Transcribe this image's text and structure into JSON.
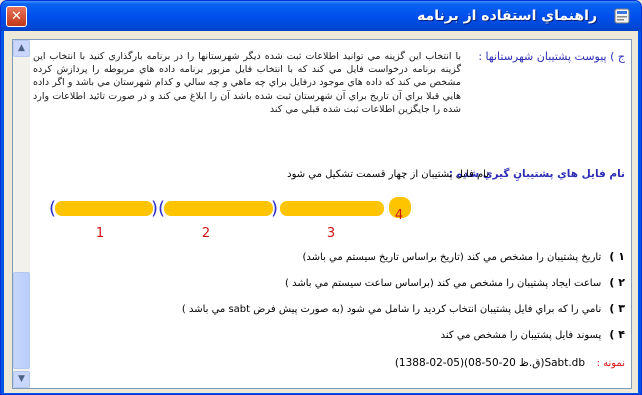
{
  "window": {
    "title": "راهنماي استفاده از برنامه",
    "close_glyph": "✕"
  },
  "section": {
    "heading": "ج )  پيوست پشتيبان شهرستانها :",
    "paragraph": "با انتخاب اين گزينه مي توانيد اطلاعات ثبت شده ديگر شهرستانها را در برنامه بارگذاري كنيد با انتخاب اين گزينه برنامه درخواست فايل مي كند كه با انتخاب فايل مزبور برنامه داده هاي مربوطه را پردازش كرده مشخص مي كند كه داده هاي موجود درفايل براي چه ماهي و چه سالي و كدام شهرستان مي باشد و اگر داده هايي قبلا براي آن تاريخ براي آن شهرستان ثبت شده باشد آن را ابلاغ مي كند و در صورت تائيد اطلاعات وارد شده را جايگزين اطلاعات ثبت شده قبلي مي كند"
  },
  "file_format": {
    "label": "نام فايل هاي پشتيبانِ گيري شده :",
    "description": "نام فايل پشتيبان از چهار قسمت تشكيل مي شود",
    "diagram": {
      "segment_numbers": [
        "1",
        "2",
        "3",
        "4"
      ]
    },
    "items": [
      {
        "num": "۱ )",
        "text": "تاريخ پشتيبان را مشخص مي كند (تاريخ براساس تاريخ سيستم مي باشد)"
      },
      {
        "num": "۲ )",
        "text": "ساعت ايجاد پشتيبان را مشخص مي كند (براساس ساعت سيستم مي باشد )"
      },
      {
        "num": "۳ )",
        "text": "نامي را كه براي فايل پشتيبان انتخاب كرديد را شامل مي شود (به صورت پيش فرض sabt مي باشد )"
      },
      {
        "num": "۴ )",
        "text": "پسوند فايل پشتيبان را مشخص مي كند"
      }
    ],
    "example_label": "نمونه :",
    "example_value": "(1388-02-05)(08-50-20 ق.ظ)Sabt.db"
  },
  "colors": {
    "heading_blue": "#2d2db5",
    "segment_yellow": "#ffc400",
    "segment_number_red": "#d01414",
    "bracket_blue": "#3030c8"
  }
}
